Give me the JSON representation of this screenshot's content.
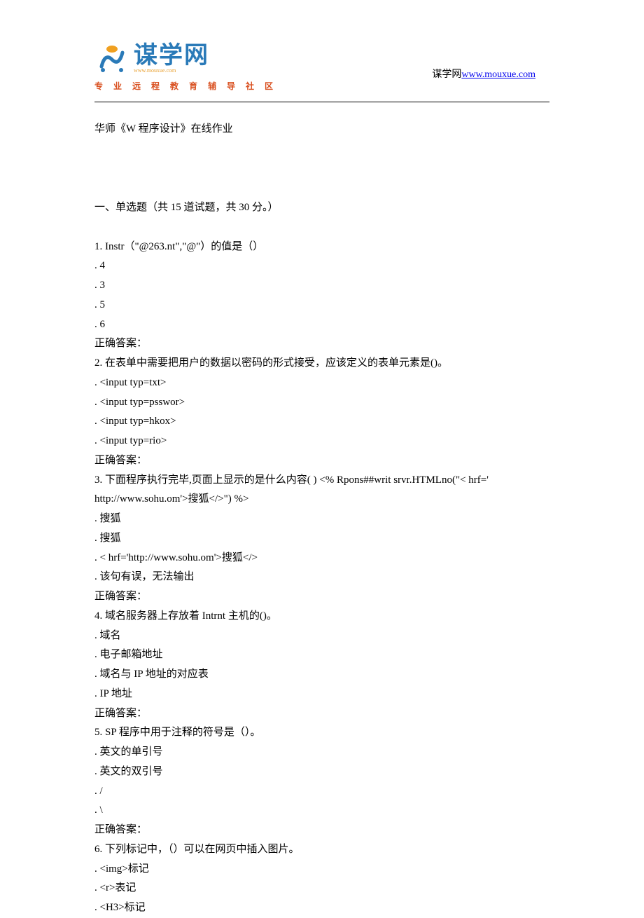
{
  "header": {
    "logo_text": "谋学网",
    "logo_sub": "www.mouxue.com",
    "logo_tagline": "专 业 远 程 教 育 辅 导 社 区",
    "site_label": "谋学网",
    "site_url": "www.mouxue.com"
  },
  "doc": {
    "title": "华师《W 程序设计》在线作业",
    "section_heading": "一、单选题（共 15 道试题，共 30 分。）",
    "q1": {
      "stem": "1.  Instr（\"@263.nt\",\"@\"）的值是（）",
      "a": ". 4",
      "b": ". 3",
      "c": ". 5",
      "d": ". 6",
      "ans": "正确答案："
    },
    "q2": {
      "stem": "2.  在表单中需要把用户的数据以密码的形式接受，应该定义的表单元素是()。",
      "a": ". <input  typ=txt>",
      "b": ". <input  typ=psswor>",
      "c": ". <input  typ=hkox>",
      "d": ". <input  typ=rio>",
      "ans": "正确答案："
    },
    "q3": {
      "stem1": "3.  下面程序执行完毕,页面上显示的是什么内容( )  <% Rpons##writ srvr.HTMLno(\"< hrf='",
      "stem2": "http://www.sohu.om'>搜狐</>\") %>",
      "a": ". 搜狐",
      "b": ". 搜狐",
      "c": ". < hrf='http://www.sohu.om'>搜狐</>",
      "d": ". 该句有误，无法输出",
      "ans": "正确答案："
    },
    "q4": {
      "stem": "4.  域名服务器上存放着 Intrnt 主机的()。",
      "a": ". 域名",
      "b": ". 电子邮箱地址",
      "c": ". 域名与 IP 地址的对应表",
      "d": ". IP 地址",
      "ans": "正确答案："
    },
    "q5": {
      "stem": "5.  SP 程序中用于注释的符号是（）。",
      "a": ". 英文的单引号",
      "b": ". 英文的双引号",
      "c": ". /",
      "d": ". \\",
      "ans": "正确答案："
    },
    "q6": {
      "stem": "6.  下列标记中，（）可以在网页中插入图片。",
      "a": ". <img>标记",
      "b": ". <r>表记",
      "c": ". <H3>标记"
    }
  }
}
